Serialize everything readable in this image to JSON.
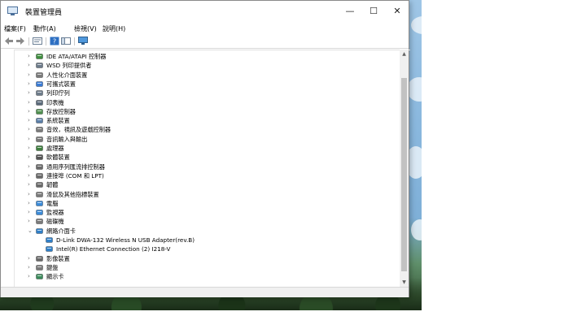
{
  "window": {
    "title": "裝置管理員",
    "minimize_glyph": "—",
    "maximize_glyph": "☐",
    "close_glyph": "✕"
  },
  "menu": [
    "檔案(F)",
    "動作(A)",
    "檢視(V)",
    "說明(H)"
  ],
  "toolbar": {
    "icons": [
      "back-icon",
      "forward-icon",
      "properties-icon",
      "help-icon",
      "view-icon",
      "monitor-scan-icon"
    ]
  },
  "tree": {
    "collapsed_glyph": "›",
    "expanded_glyph": "⌄",
    "items": [
      {
        "label": "IDE ATA/ATAPI 控制器",
        "icon": "disk-controller-icon",
        "color": "#3e8e3e"
      },
      {
        "label": "WSD 列印提供者",
        "icon": "printer-icon",
        "color": "#6d7b8a"
      },
      {
        "label": "人性化介面裝置",
        "icon": "hid-icon",
        "color": "#7a7a7a"
      },
      {
        "label": "可攜式裝置",
        "icon": "portable-device-icon",
        "color": "#3a7bd5"
      },
      {
        "label": "列印佇列",
        "icon": "print-queue-icon",
        "color": "#6d7b8a"
      },
      {
        "label": "印表機",
        "icon": "printer-icon",
        "color": "#5a6a7a"
      },
      {
        "label": "存放控制器",
        "icon": "storage-controller-icon",
        "color": "#4f8f4f"
      },
      {
        "label": "系統裝置",
        "icon": "system-device-icon",
        "color": "#5b7fa8"
      },
      {
        "label": "音效，視訊及遊戲控制器",
        "icon": "sound-icon",
        "color": "#7a7a7a"
      },
      {
        "label": "音訊輸入與輸出",
        "icon": "audio-io-icon",
        "color": "#7a7a7a"
      },
      {
        "label": "處理器",
        "icon": "processor-icon",
        "color": "#3f7f3f"
      },
      {
        "label": "軟體裝置",
        "icon": "software-device-icon",
        "color": "#555555"
      },
      {
        "label": "通用序列匯流排控制器",
        "icon": "usb-icon",
        "color": "#6a6a6a"
      },
      {
        "label": "連接埠 (COM 和 LPT)",
        "icon": "port-icon",
        "color": "#6a6a6a"
      },
      {
        "label": "韌體",
        "icon": "firmware-icon",
        "color": "#6a6a6a"
      },
      {
        "label": "滑鼠及其他指標裝置",
        "icon": "mouse-icon",
        "color": "#7a7a7a"
      },
      {
        "label": "電腦",
        "icon": "computer-icon",
        "color": "#3a8ad8"
      },
      {
        "label": "監視器",
        "icon": "monitor-icon",
        "color": "#3a8ad8"
      },
      {
        "label": "磁碟機",
        "icon": "disk-drive-icon",
        "color": "#7a7a7a"
      },
      {
        "label": "網路介面卡",
        "icon": "network-adapter-icon",
        "color": "#2f7fc8",
        "expanded": true,
        "children": [
          {
            "label": "D-Link DWA-132 Wireless N USB Adapter(rev.B)",
            "icon": "network-adapter-icon",
            "color": "#2f7fc8"
          },
          {
            "label": "Intel(R) Ethernet Connection (2) I218-V",
            "icon": "network-adapter-icon",
            "color": "#2f7fc8"
          }
        ]
      },
      {
        "label": "影像裝置",
        "icon": "imaging-device-icon",
        "color": "#6a6a6a"
      },
      {
        "label": "鍵盤",
        "icon": "keyboard-icon",
        "color": "#7a7a7a"
      },
      {
        "label": "顯示卡",
        "icon": "display-adapter-icon",
        "color": "#3a8a5a"
      }
    ]
  },
  "scrollbar": {
    "up_glyph": "▲",
    "down_glyph": "▼"
  }
}
